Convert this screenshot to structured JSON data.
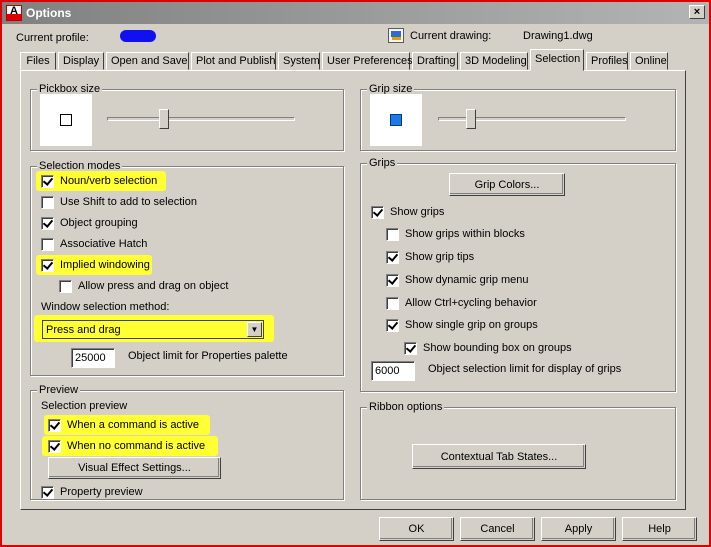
{
  "window": {
    "title": "Options",
    "app_icon_letter": "A",
    "close_glyph": "×"
  },
  "header": {
    "profile_label": "Current profile:",
    "drawing_label": "Current drawing:",
    "drawing_value": "Drawing1.dwg"
  },
  "tabs": [
    {
      "label": "Files",
      "active": false
    },
    {
      "label": "Display",
      "active": false
    },
    {
      "label": "Open and Save",
      "active": false
    },
    {
      "label": "Plot and Publish",
      "active": false
    },
    {
      "label": "System",
      "active": false
    },
    {
      "label": "User Preferences",
      "active": false
    },
    {
      "label": "Drafting",
      "active": false
    },
    {
      "label": "3D Modeling",
      "active": false
    },
    {
      "label": "Selection",
      "active": true
    },
    {
      "label": "Profiles",
      "active": false
    },
    {
      "label": "Online",
      "active": false
    }
  ],
  "pickbox": {
    "title": "Pickbox size",
    "slider_fraction": 0.3
  },
  "gripsize": {
    "title": "Grip size",
    "slider_fraction": 0.17
  },
  "selection_modes": {
    "title": "Selection modes",
    "noun_verb": {
      "label": "Noun/verb selection",
      "checked": true
    },
    "use_shift": {
      "label": "Use Shift to add to selection",
      "checked": false
    },
    "object_grouping": {
      "label": "Object grouping",
      "checked": true
    },
    "associative_hatch": {
      "label": "Associative Hatch",
      "checked": false
    },
    "implied_windowing": {
      "label": "Implied windowing",
      "checked": true
    },
    "allow_press_drag": {
      "label": "Allow press and drag on object",
      "checked": false
    },
    "window_method_label": "Window selection method:",
    "window_method_value": "Press and drag",
    "object_limit_value": "25000",
    "object_limit_label": "Object limit for Properties palette"
  },
  "preview": {
    "title": "Preview",
    "selection_preview_label": "Selection preview",
    "when_active": {
      "label": "When a command is active",
      "checked": true
    },
    "when_no_command": {
      "label": "When no command is active",
      "checked": true
    },
    "visual_effect_button": "Visual Effect Settings...",
    "property_preview": {
      "label": "Property preview",
      "checked": true
    }
  },
  "grips": {
    "title": "Grips",
    "grip_colors_button": "Grip Colors...",
    "show_grips": {
      "label": "Show grips",
      "checked": true
    },
    "within_blocks": {
      "label": "Show grips within blocks",
      "checked": false
    },
    "grip_tips": {
      "label": "Show grip tips",
      "checked": true
    },
    "dynamic_menu": {
      "label": "Show dynamic grip menu",
      "checked": true
    },
    "ctrl_cycling": {
      "label": "Allow Ctrl+cycling behavior",
      "checked": false
    },
    "single_grip": {
      "label": "Show single grip on groups",
      "checked": true
    },
    "bounding_box": {
      "label": "Show bounding box on groups",
      "checked": true
    },
    "limit_value": "6000",
    "limit_label": "Object selection limit for display of grips"
  },
  "ribbon": {
    "title": "Ribbon options",
    "contextual_button": "Contextual Tab States..."
  },
  "footer": {
    "ok": "OK",
    "cancel": "Cancel",
    "apply": "Apply",
    "help": "Help"
  },
  "colors": {
    "highlight": "#ffff33",
    "dialog_face": "#d4d0c8",
    "window_border": "#e00000"
  }
}
